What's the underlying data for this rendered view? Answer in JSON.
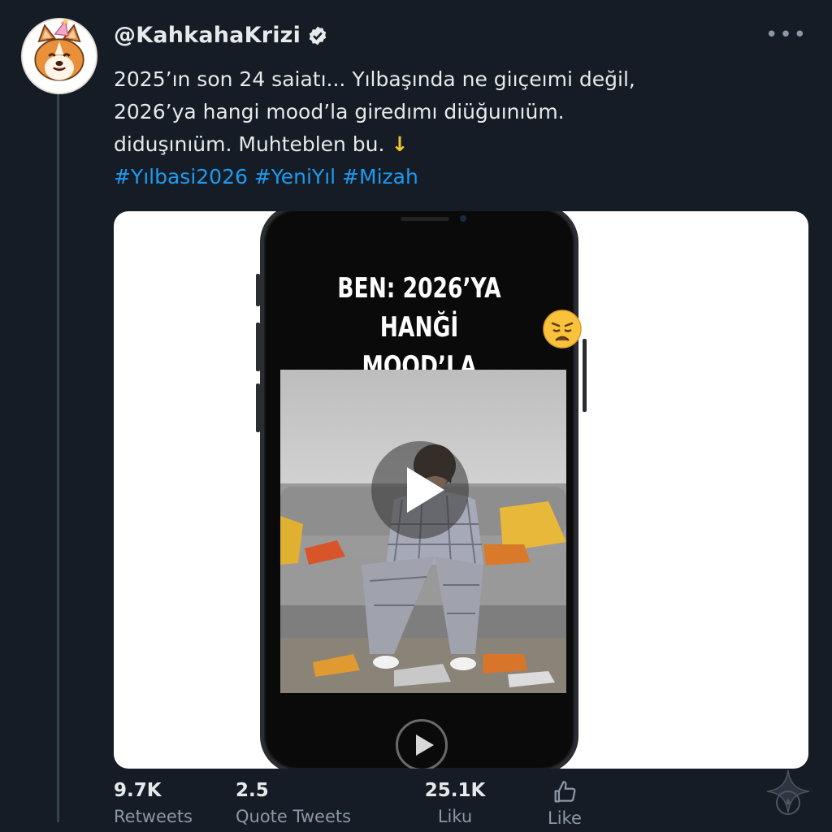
{
  "tweet": {
    "handle": "@KahkahaKrizi",
    "text_lines": [
      "2025’ın son 24 saiatı... Yılbaşında ne giıçeımi değil,",
      "2026’ya hangi mood’la giredımı diüğuınıüm.",
      "diduşınıüm. Muhteblen bu."
    ],
    "arrow_glyph": "↓",
    "hashtags": [
      "#Yılbasi2026",
      "#YeniYıl",
      "#Mizah"
    ]
  },
  "media": {
    "caption_lines": [
      "BEN: 2026’YA HANĞİ",
      "MOOD’LA GİRYÖRÜM..."
    ]
  },
  "stats": {
    "retweets": {
      "value": "9.7K",
      "label": "Retweets"
    },
    "quote_tweets": {
      "value": "2.5",
      "label": "Quote Tweets"
    },
    "likes": {
      "value": "25.1K",
      "label": "Liku"
    },
    "like_action": {
      "label": "Like"
    }
  },
  "colors": {
    "background": "#151c25",
    "hashtag": "#1d9bf0",
    "muted": "#8b98a5",
    "verified": "#1d9bf0"
  },
  "icons": [
    "corgi-party-avatar-icon",
    "verified-badge-icon",
    "more-options-icon",
    "arrow-down-icon",
    "sad-face-emoji-icon",
    "play-icon",
    "thumbs-up-icon",
    "sparkle-icon"
  ]
}
